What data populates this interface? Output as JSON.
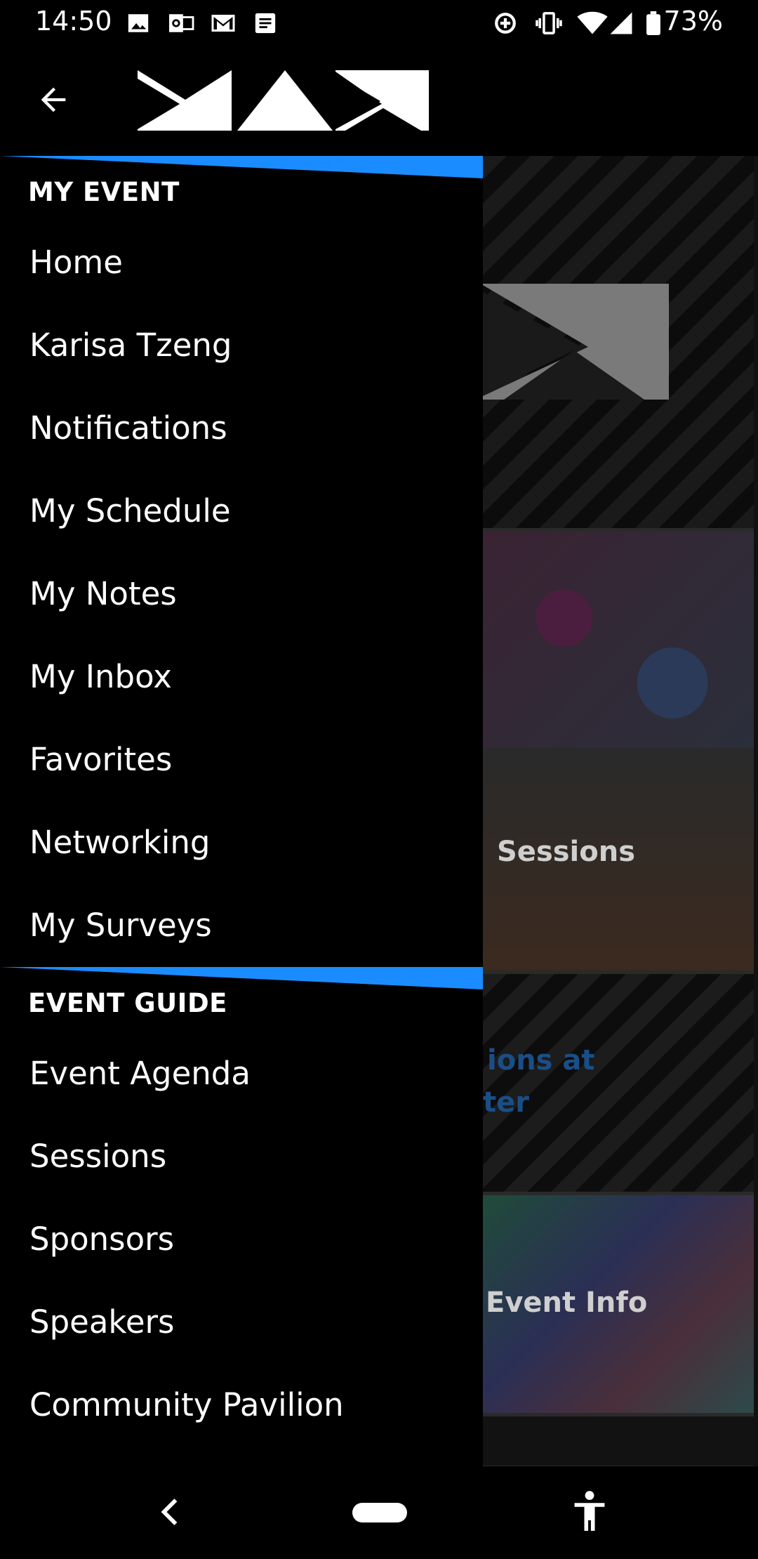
{
  "status_bar": {
    "time": "14:50",
    "battery_percent": "73%",
    "icons": [
      "photo-icon",
      "outlook-icon",
      "gmail-icon",
      "docs-icon",
      "data-saver-icon",
      "vibrate-icon",
      "wifi-icon",
      "signal-icon",
      "battery-icon"
    ]
  },
  "app_bar": {
    "back_icon": "arrow-left-icon",
    "logo": "MAX"
  },
  "drawer": {
    "accent_color": "#1a8cff",
    "sections": [
      {
        "title": "MY EVENT",
        "items": [
          "Home",
          "Karisa Tzeng",
          "Notifications",
          "My Schedule",
          "My Notes",
          "My Inbox",
          "Favorites",
          "Networking",
          "My Surveys"
        ]
      },
      {
        "title": "EVENT GUIDE",
        "items": [
          "Event Agenda",
          "Sessions",
          "Sponsors",
          "Speakers",
          "Community Pavilion"
        ]
      }
    ]
  },
  "background_tiles": {
    "labels": [
      "Sessions",
      "ions at",
      "ter",
      "Event Info"
    ]
  },
  "system_nav": {
    "back_icon": "chevron-left-icon",
    "home_icon": "home-pill-icon",
    "accessibility_icon": "accessibility-icon"
  }
}
